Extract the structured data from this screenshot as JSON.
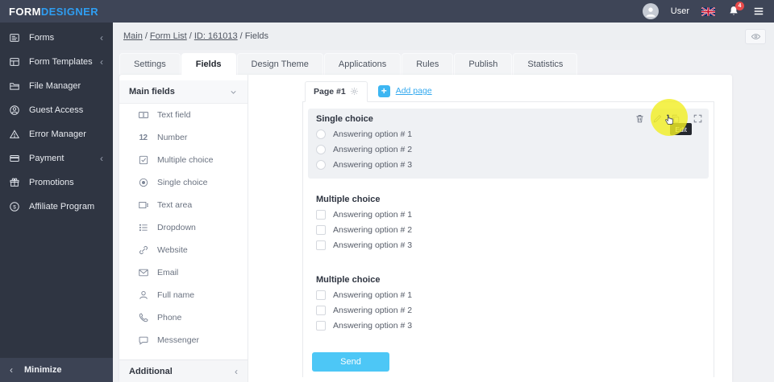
{
  "colors": {
    "accent_blue": "#2f9ef2",
    "add_page_blue": "#3db6f2",
    "send_blue": "#4dc7f6",
    "highlight_yellow": "#f2ee26",
    "notification_red": "#e84a4a",
    "topbar_bg": "#3e4557",
    "sidebar_bg": "#2f3542"
  },
  "header": {
    "logo_primary": "FORM",
    "logo_secondary": "DESIGNER",
    "user_label": "User",
    "notification_count": "4"
  },
  "sidebar": {
    "items": [
      {
        "label": "Forms",
        "expandable": true
      },
      {
        "label": "Form Templates",
        "expandable": true
      },
      {
        "label": "File Manager",
        "expandable": false
      },
      {
        "label": "Guest Access",
        "expandable": false
      },
      {
        "label": "Error Manager",
        "expandable": false
      },
      {
        "label": "Payment",
        "expandable": true
      },
      {
        "label": "Promotions",
        "expandable": false
      },
      {
        "label": "Affiliate Program",
        "expandable": false
      }
    ],
    "minimize_label": "Minimize",
    "chevron": "‹"
  },
  "breadcrumb": {
    "main": "Main",
    "form_list": "Form List",
    "form_id": "ID: 161013",
    "current": "Fields",
    "separator": "/"
  },
  "tabs": {
    "items": [
      {
        "label": "Settings"
      },
      {
        "label": "Fields",
        "active": true
      },
      {
        "label": "Design Theme"
      },
      {
        "label": "Applications"
      },
      {
        "label": "Rules"
      },
      {
        "label": "Publish"
      },
      {
        "label": "Statistics"
      }
    ]
  },
  "fields_panel": {
    "header": "Main fields",
    "items": [
      {
        "label": "Text field"
      },
      {
        "label": "Number",
        "icon_text": "12"
      },
      {
        "label": "Multiple choice"
      },
      {
        "label": "Single choice"
      },
      {
        "label": "Text area"
      },
      {
        "label": "Dropdown"
      },
      {
        "label": "Website"
      },
      {
        "label": "Email"
      },
      {
        "label": "Full name"
      },
      {
        "label": "Phone"
      },
      {
        "label": "Messenger"
      }
    ],
    "footer": "Additional",
    "footer_chevron": "‹"
  },
  "page_bar": {
    "page_tab": "Page #1",
    "add_page": "Add page",
    "plus": "+"
  },
  "form": {
    "blocks": [
      {
        "type": "radio",
        "title": "Single choice",
        "selected": true,
        "options": [
          "Answering option # 1",
          "Answering option # 2",
          "Answering option # 3"
        ]
      },
      {
        "type": "checkbox",
        "title": "Multiple choice",
        "options": [
          "Answering option # 1",
          "Answering option # 2",
          "Answering option # 3"
        ]
      },
      {
        "type": "checkbox",
        "title": "Multiple choice",
        "options": [
          "Answering option # 1",
          "Answering option # 2",
          "Answering option # 3"
        ]
      }
    ],
    "toolbar_tooltip": "Edit",
    "send_label": "Send"
  }
}
